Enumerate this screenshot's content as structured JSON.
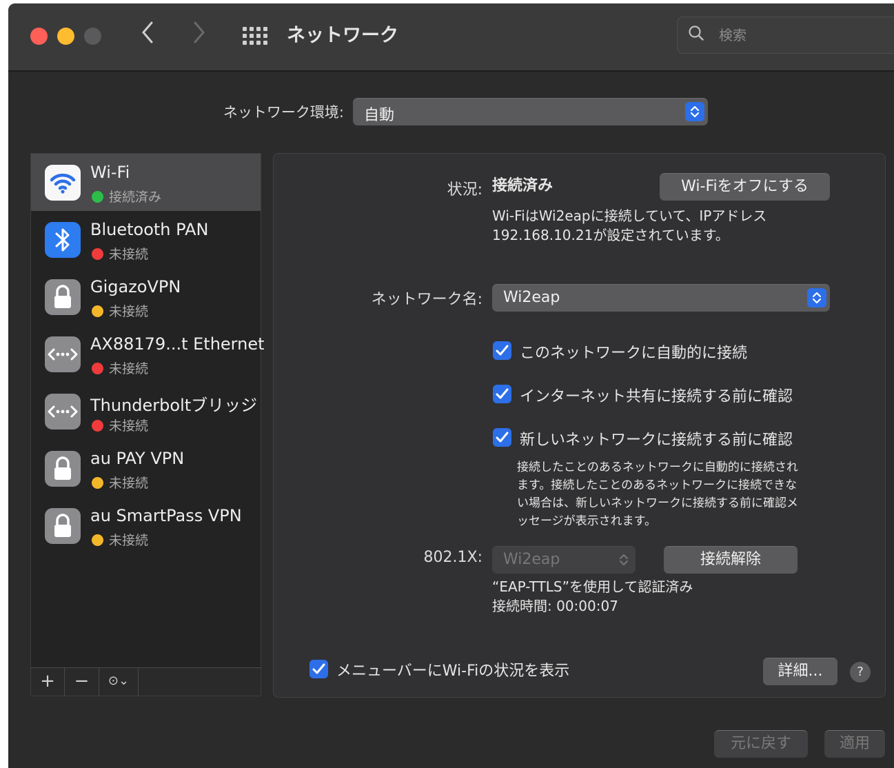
{
  "window": {
    "title": "ネットワーク",
    "search": {
      "placeholder": "検索"
    }
  },
  "location": {
    "label": "ネットワーク環境:",
    "value": "自動"
  },
  "services": [
    {
      "name": "Wi-Fi",
      "status": "接続済み",
      "status_color": "#2dbe4a",
      "icon": "wifi-icon",
      "selected": true
    },
    {
      "name": "Bluetooth PAN",
      "status": "未接続",
      "status_color": "#ef3b3b",
      "icon": "bluetooth-icon"
    },
    {
      "name": "GigazoVPN",
      "status": "未接続",
      "status_color": "#f5b72a",
      "icon": "lock-icon"
    },
    {
      "name": "AX88179...t Ethernet",
      "status": "未接続",
      "status_color": "#ef3b3b",
      "icon": "ethernet-icon"
    },
    {
      "name": "Thunderboltブリッジ",
      "status": "未接続",
      "status_color": "#ef3b3b",
      "icon": "ethernet-icon"
    },
    {
      "name": "au PAY VPN",
      "status": "未接続",
      "status_color": "#f5b72a",
      "icon": "lock-icon"
    },
    {
      "name": "au SmartPass VPN",
      "status": "未接続",
      "status_color": "#f5b72a",
      "icon": "lock-icon"
    }
  ],
  "sidebar_toolbar": {
    "add": "+",
    "remove": "−",
    "actions": "⊙⌄"
  },
  "detail": {
    "status_label": "状況:",
    "status_value": "接続済み",
    "wifi_off_button": "Wi-Fiをオフにする",
    "status_desc_1": "Wi-FiはWi2eapに接続していて、IPアドレス",
    "status_desc_2": "192.168.10.21が設定されています。",
    "network_name_label": "ネットワーク名:",
    "network_name_value": "Wi2eap",
    "check_auto_join": "このネットワークに自動的に接続",
    "check_hotspot": "インターネット共有に接続する前に確認",
    "check_new_network": "新しいネットワークに接続する前に確認",
    "note_1": "接続したことのあるネットワークに自動的に接続され",
    "note_2": "ます。接続したことのあるネットワークに接続できな",
    "note_3": "い場合は、新しいネットワークに接続する前に確認メ",
    "note_4": "ッセージが表示されます。",
    "dot1x_label": "802.1X:",
    "dot1x_value": "Wi2eap",
    "disconnect_button": "接続解除",
    "auth_text": "“EAP-TTLS”を使用して認証済み",
    "connect_time": "接続時間: 00:00:07",
    "menubar_check": "メニューバーにWi-Fiの状況を表示",
    "advanced_button": "詳細...",
    "help": "?"
  },
  "footer": {
    "revert": "元に戻す",
    "apply": "適用"
  },
  "colors": {
    "accent": "#2d6fe8",
    "window_bg": "#2b2b2c"
  }
}
